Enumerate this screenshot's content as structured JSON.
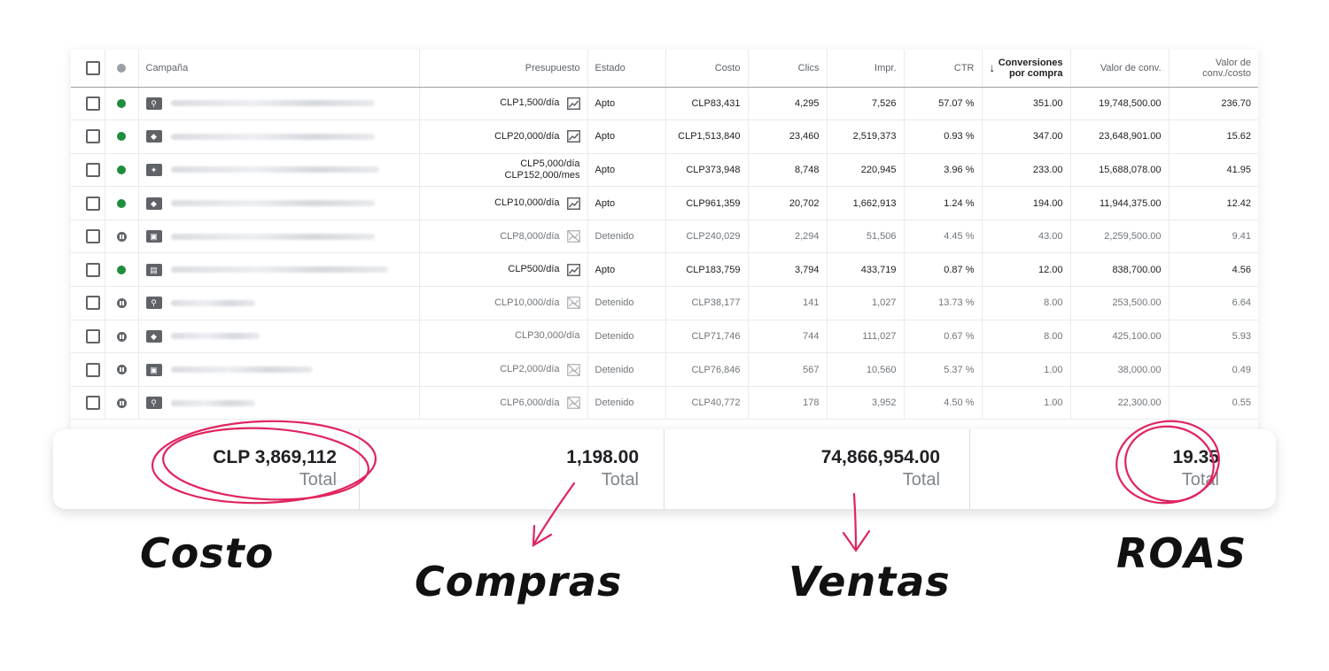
{
  "table": {
    "headers": {
      "campaign": "Campaña",
      "budget": "Presupuesto",
      "status": "Estado",
      "cost": "Costo",
      "clicks": "Clics",
      "impr": "Impr.",
      "ctr": "CTR",
      "conv_line1": "Conversiones",
      "conv_line2": "por compra",
      "value": "Valor de conv.",
      "roas_line1": "Valor de",
      "roas_line2": "conv./costo"
    },
    "rows": [
      {
        "type_icon": "search-icon",
        "status_dot": "green",
        "budget": "CLP1,500/día",
        "budget2": "",
        "trend": "trend-icon",
        "status": "Apto",
        "cost": "CLP83,431",
        "clicks": "4,295",
        "impr": "7,526",
        "ctr": "57.07 %",
        "conv": "351.00",
        "value": "19,748,500.00",
        "roas": "236.70"
      },
      {
        "type_icon": "tag-icon",
        "status_dot": "green",
        "budget": "CLP20,000/día",
        "budget2": "",
        "trend": "trend-icon",
        "status": "Apto",
        "cost": "CLP1,513,840",
        "clicks": "23,460",
        "impr": "2,519,373",
        "ctr": "0.93 %",
        "conv": "347.00",
        "value": "23,648,901.00",
        "roas": "15.62"
      },
      {
        "type_icon": "magic-wand-icon",
        "status_dot": "green",
        "budget": "CLP5,000/día",
        "budget2": "CLP152,000/mes",
        "trend": "",
        "status": "Apto",
        "cost": "CLP373,948",
        "clicks": "8,748",
        "impr": "220,945",
        "ctr": "3.96 %",
        "conv": "233.00",
        "value": "15,688,078.00",
        "roas": "41.95"
      },
      {
        "type_icon": "tag-icon",
        "status_dot": "green",
        "budget": "CLP10,000/día",
        "budget2": "",
        "trend": "trend-icon",
        "status": "Apto",
        "cost": "CLP961,359",
        "clicks": "20,702",
        "impr": "1,662,913",
        "ctr": "1.24 %",
        "conv": "194.00",
        "value": "11,944,375.00",
        "roas": "12.42"
      },
      {
        "type_icon": "display-search-icon",
        "status_dot": "paused",
        "budget": "CLP8,000/día",
        "budget2": "",
        "trend": "trend-off-icon",
        "status": "Detenido",
        "cost": "CLP240,029",
        "clicks": "2,294",
        "impr": "51,506",
        "ctr": "4.45 %",
        "conv": "43.00",
        "value": "2,259,500.00",
        "roas": "9.41"
      },
      {
        "type_icon": "display-icon",
        "status_dot": "green",
        "budget": "CLP500/día",
        "budget2": "",
        "trend": "trend-icon",
        "status": "Apto",
        "cost": "CLP183,759",
        "clicks": "3,794",
        "impr": "433,719",
        "ctr": "0.87 %",
        "conv": "12.00",
        "value": "838,700.00",
        "roas": "4.56"
      },
      {
        "type_icon": "search-icon",
        "status_dot": "paused",
        "budget": "CLP10,000/día",
        "budget2": "",
        "trend": "trend-off-icon",
        "status": "Detenido",
        "cost": "CLP38,177",
        "clicks": "141",
        "impr": "1,027",
        "ctr": "13.73 %",
        "conv": "8.00",
        "value": "253,500.00",
        "roas": "6.64"
      },
      {
        "type_icon": "tag-icon",
        "status_dot": "paused",
        "budget": "CLP30,000/día",
        "budget2": "",
        "trend": "",
        "status": "Detenido",
        "cost": "CLP71,746",
        "clicks": "744",
        "impr": "111,027",
        "ctr": "0.67 %",
        "conv": "8.00",
        "value": "425,100.00",
        "roas": "5.93"
      },
      {
        "type_icon": "display-search-icon",
        "status_dot": "paused",
        "budget": "CLP2,000/día",
        "budget2": "",
        "trend": "trend-off-icon",
        "status": "Detenido",
        "cost": "CLP76,846",
        "clicks": "567",
        "impr": "10,560",
        "ctr": "5.37 %",
        "conv": "1.00",
        "value": "38,000.00",
        "roas": "0.49"
      },
      {
        "type_icon": "search-icon",
        "status_dot": "paused",
        "budget": "CLP6,000/día",
        "budget2": "",
        "trend": "trend-off-icon",
        "status": "Detenido",
        "cost": "CLP40,772",
        "clicks": "178",
        "impr": "3,952",
        "ctr": "4.50 %",
        "conv": "1.00",
        "value": "22,300.00",
        "roas": "0.55"
      }
    ]
  },
  "summary": {
    "cost_value": "CLP 3,869,112",
    "cost_label": "Total",
    "purchases_value": "1,198.00",
    "purchases_label": "Total",
    "sales_value": "74,866,954.00",
    "sales_label": "Total",
    "roas_value": "19.35",
    "roas_label": "Total"
  },
  "annotations": {
    "cost": "Costo",
    "purchases": "Compras",
    "sales": "Ventas",
    "roas": "ROAS",
    "accent_color": "#e0245e"
  }
}
